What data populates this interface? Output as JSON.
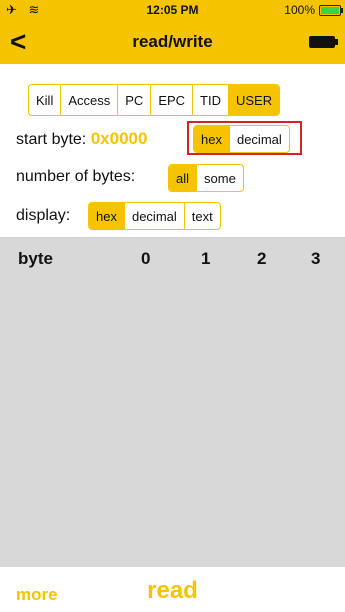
{
  "status_bar": {
    "left_icons": "✈ ≋",
    "time": "12:05 PM",
    "battery_text": "100%"
  },
  "nav": {
    "back_glyph": "<",
    "title": "read/write"
  },
  "tabs": [
    "Kill",
    "Access",
    "PC",
    "EPC",
    "TID",
    "USER"
  ],
  "tabs_active": "USER",
  "start_byte": {
    "label": "start byte:",
    "value": "0x0000",
    "options": [
      "hex",
      "decimal"
    ],
    "active": "hex"
  },
  "number_of_bytes": {
    "label": "number of bytes:",
    "options": [
      "all",
      "some"
    ],
    "active": "all"
  },
  "display": {
    "label": "display:",
    "options": [
      "hex",
      "decimal",
      "text"
    ],
    "active": "hex"
  },
  "table": {
    "headers": [
      "byte",
      "0",
      "1",
      "2",
      "3"
    ]
  },
  "bottom": {
    "more_label": "more",
    "read_label": "read"
  },
  "colors": {
    "accent": "#f5c400",
    "highlight": "#d62222",
    "table_bg": "#d8d8d8"
  }
}
